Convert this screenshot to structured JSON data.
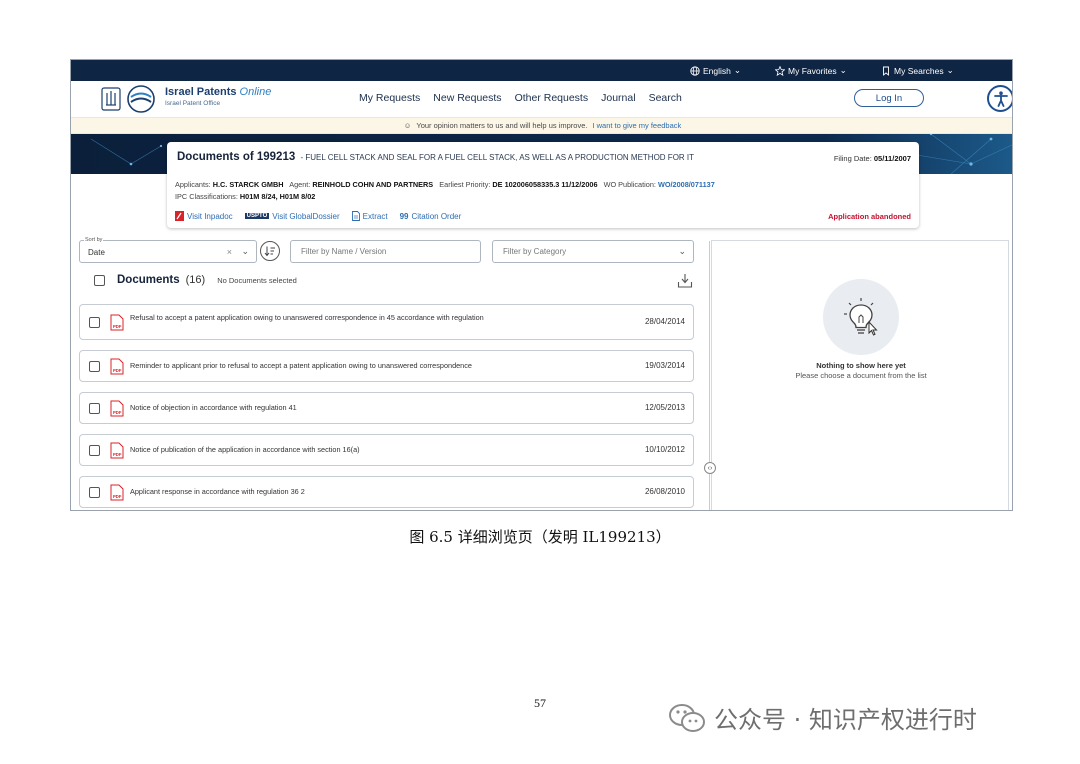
{
  "topbar": {
    "language": "English",
    "favorites": "My Favorites",
    "searches": "My Searches"
  },
  "header": {
    "brand_main": "Israel Patents",
    "brand_online": "Online",
    "brand_sub": "Israel Patent Office",
    "nav": [
      "My Requests",
      "New Requests",
      "Other Requests",
      "Journal",
      "Search"
    ],
    "login": "Log In"
  },
  "feedback": {
    "text": "Your opinion matters to us and will help us improve.",
    "link": "I want to give my feedback"
  },
  "document": {
    "title": "Documents of 199213",
    "subtitle": "- FUEL CELL STACK AND SEAL FOR A FUEL CELL STACK, AS WELL AS A PRODUCTION METHOD FOR IT",
    "filing_label": "Filing Date:",
    "filing_date": "05/11/2007",
    "applicants_label": "Applicants:",
    "applicants": "H.C. STARCK GMBH",
    "agent_label": "Agent:",
    "agent": "REINHOLD COHN AND PARTNERS",
    "priority_label": "Earliest Priority:",
    "priority": "DE 102006058335.3 11/12/2006",
    "wo_label": "WO Publication:",
    "wo": "WO/2008/071137",
    "ipc_label": "IPC Classifications:",
    "ipc": "H01M 8/24, H01M 8/02",
    "links": {
      "inpadoc": "Visit Inpadoc",
      "uspto": "USPTO",
      "globaldossier": "Visit GlobalDossier",
      "extract": "Extract",
      "citation": "Citation Order"
    },
    "status": "Application abandoned"
  },
  "filters": {
    "sort_label": "Sort by",
    "sort_value": "Date",
    "name_placeholder": "Filter by Name / Version",
    "category_placeholder": "Filter by Category"
  },
  "documents": {
    "title": "Documents",
    "count": "(16)",
    "selected": "No Documents selected",
    "rows": [
      {
        "text": "Refusal to accept a patent application owing to unanswered correspondence in 45 accordance with regulation",
        "date": "28/04/2014"
      },
      {
        "text": "Reminder to applicant prior to refusal to accept a patent application owing to unanswered correspondence",
        "date": "19/03/2014"
      },
      {
        "text": "Notice of objection in accordance with regulation 41",
        "date": "12/05/2013"
      },
      {
        "text": "Notice of publication of the application in accordance with section 16(a)",
        "date": "10/10/2012"
      },
      {
        "text": "Applicant response in accordance with regulation 36 2",
        "date": "26/08/2010"
      }
    ]
  },
  "preview": {
    "empty_title": "Nothing to show here yet",
    "empty_sub": "Please choose a document from the list"
  },
  "page": {
    "caption": "图 6.5 详细浏览页（发明 IL199213）",
    "number": "57",
    "watermark": "公众号 · 知识产权进行时"
  },
  "icons": {
    "globe": "globe-icon",
    "star": "star-icon",
    "bookmark": "bookmark-icon",
    "accessibility": "accessibility-icon",
    "pdf": "pdf-file-icon",
    "lightbulb": "lightbulb-icon",
    "download": "download-icon"
  },
  "colors": {
    "topbar": "#0f2544",
    "brand": "#1c3f6e",
    "link": "#2c6db3",
    "status_red": "#c4122f",
    "pdf_red": "#d8232a"
  }
}
